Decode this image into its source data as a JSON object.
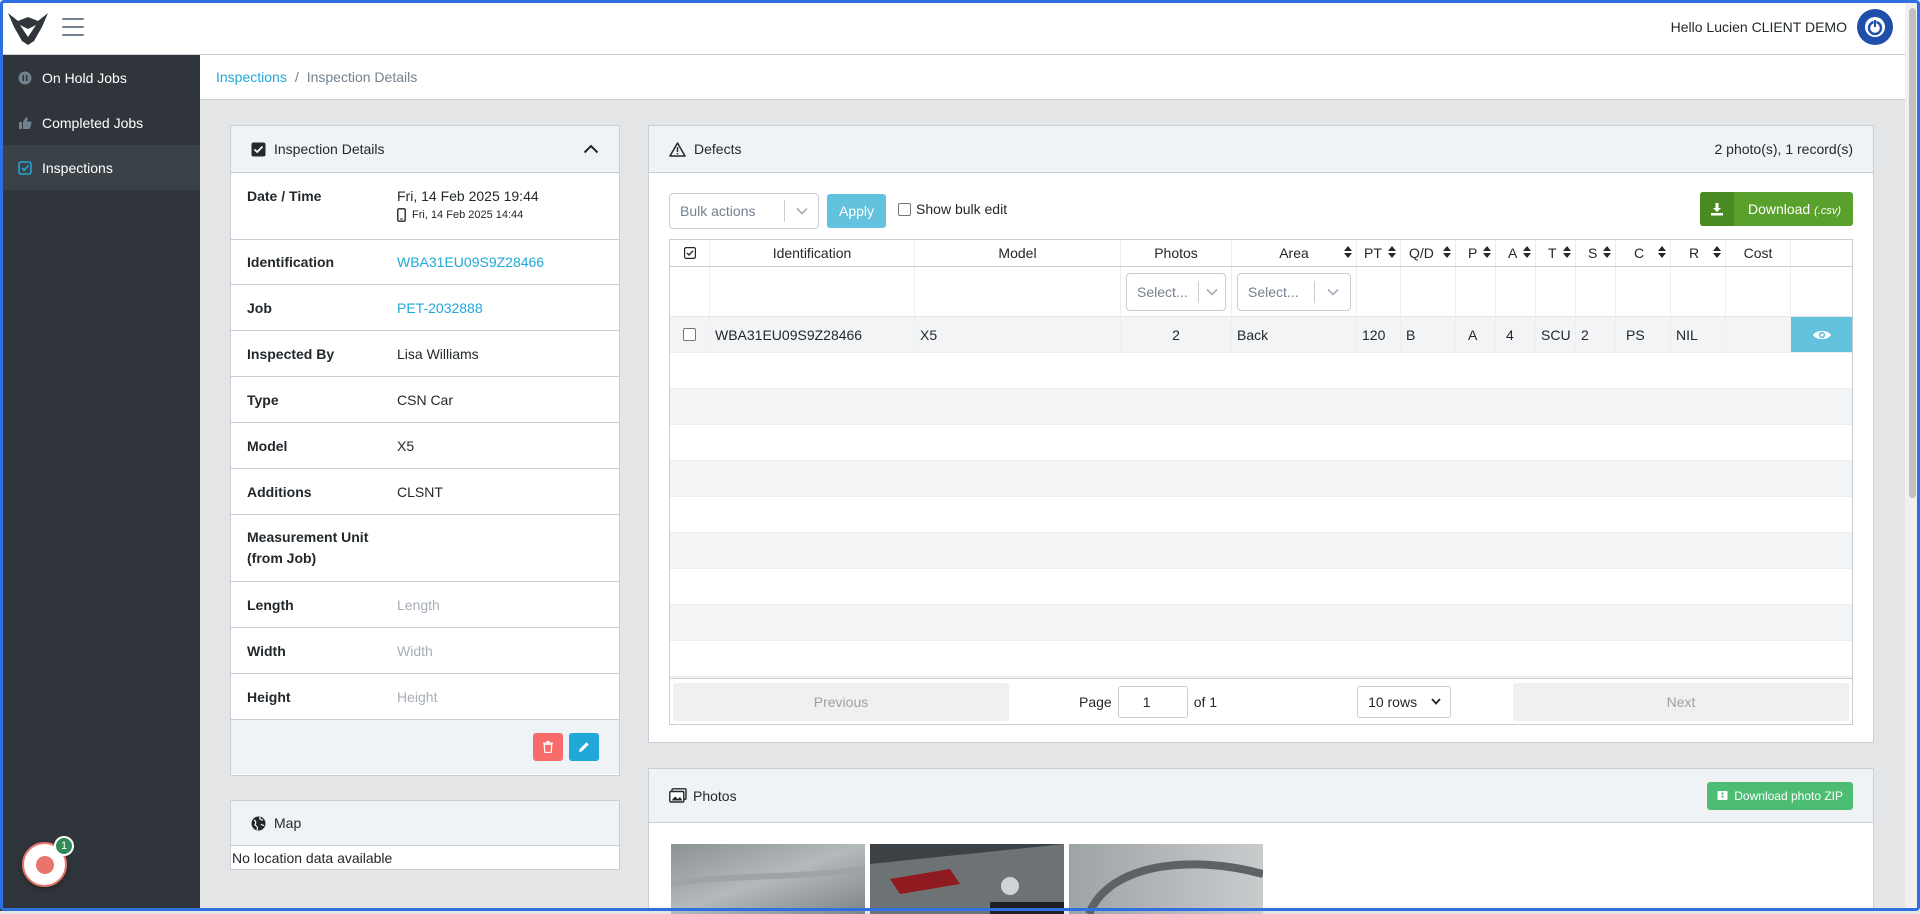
{
  "header": {
    "greeting": "Hello Lucien CLIENT DEMO"
  },
  "sidebar": {
    "items": [
      {
        "label": "On Hold Jobs",
        "icon": "pause-circle-icon"
      },
      {
        "label": "Completed Jobs",
        "icon": "thumbs-up-icon"
      },
      {
        "label": "Inspections",
        "icon": "check-square-icon",
        "active": true
      }
    ]
  },
  "breadcrumb": {
    "link": "Inspections",
    "separator": "/",
    "current": "Inspection Details"
  },
  "details": {
    "title": "Inspection Details",
    "rows": [
      {
        "label": "Date / Time",
        "value": "Fri, 14 Feb 2025 19:44",
        "sub": "Fri, 14 Feb 2025 14:44"
      },
      {
        "label": "Identification",
        "value": "WBA31EU09S9Z28466"
      },
      {
        "label": "Job",
        "value": "PET-2032888"
      },
      {
        "label": "Inspected By",
        "value": "Lisa Williams"
      },
      {
        "label": "Type",
        "value": "CSN Car"
      },
      {
        "label": "Model",
        "value": "X5"
      },
      {
        "label": "Additions",
        "value": "CLSNT"
      },
      {
        "label": "Measurement Unit (from Job)",
        "value": ""
      },
      {
        "label": "Length",
        "placeholder": "Length"
      },
      {
        "label": "Width",
        "placeholder": "Width"
      },
      {
        "label": "Height",
        "placeholder": "Height"
      }
    ]
  },
  "map": {
    "title": "Map",
    "empty": "No location data available"
  },
  "defects": {
    "title": "Defects",
    "summary": "2 photo(s), 1 record(s)",
    "bulk_placeholder": "Bulk actions",
    "apply": "Apply",
    "show_bulk_edit": "Show bulk edit",
    "download": "Download",
    "download_suffix": "(.csv)",
    "columns": [
      "Identification",
      "Model",
      "Photos",
      "Area",
      "PT",
      "Q/D",
      "P",
      "A",
      "T",
      "S",
      "C",
      "R",
      "Cost"
    ],
    "filter_placeholder": "Select...",
    "row": {
      "identification": "WBA31EU09S9Z28466",
      "model": "X5",
      "photos": "2",
      "area": "Back",
      "pt": "120",
      "qd": "B",
      "p": "A",
      "a": "4",
      "t": "SCU",
      "s": "2",
      "c": "PS",
      "r": "NIL",
      "cost": ""
    },
    "pager": {
      "previous": "Previous",
      "next": "Next",
      "page_label": "Page",
      "page": "1",
      "of": "of 1",
      "rows": "10 rows"
    }
  },
  "photos": {
    "title": "Photos",
    "download_zip": "Download photo ZIP"
  },
  "widget": {
    "badge": "1"
  },
  "colors": {
    "accent": "#20a8d8",
    "sidebar": "#2f353a",
    "success": "#4dbd74",
    "danger": "#f86c6b",
    "info": "#63c2de"
  }
}
